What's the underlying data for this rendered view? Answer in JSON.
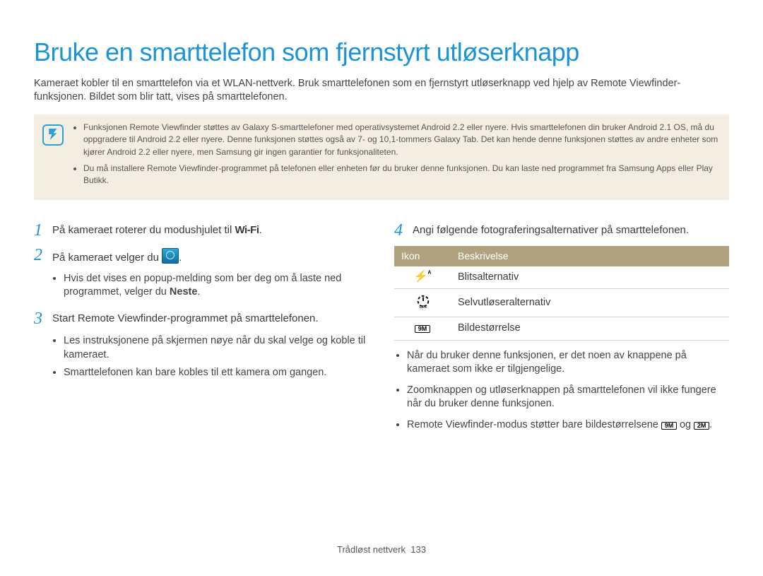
{
  "title": "Bruke en smarttelefon som fjernstyrt utløserknapp",
  "intro": "Kameraet kobler til en smarttelefon via et WLAN-nettverk. Bruk smarttelefonen som en fjernstyrt utløserknapp ved hjelp av Remote Viewfinder-funksjonen. Bildet som blir tatt, vises på smarttelefonen.",
  "notes": [
    "Funksjonen Remote Viewfinder støttes av Galaxy S-smarttelefoner med operativsystemet Android 2.2 eller nyere. Hvis smarttelefonen din bruker Android 2.1 OS, må du oppgradere til Android 2.2 eller nyere. Denne funksjonen støttes også av 7- og 10,1-tommers Galaxy Tab. Det kan hende denne funksjonen støttes av andre enheter som kjører Android 2.2 eller nyere, men Samsung gir ingen garantier for funksjonaliteten.",
    "Du må installere Remote Viewfinder-programmet på telefonen eller enheten før du bruker denne funksjonen. Du kan laste ned programmet fra Samsung Apps eller Play Butikk."
  ],
  "left": {
    "step1": {
      "num": "1",
      "pre": "På kameraet roterer du modushjulet til ",
      "wifi": "Wi-Fi",
      "post": "."
    },
    "step2": {
      "num": "2",
      "pre": "På kameraet velger du ",
      "post": "."
    },
    "step2_sub_pre": "Hvis det vises en popup-melding som ber deg om å laste ned programmet, velger du ",
    "step2_sub_bold": "Neste",
    "step2_sub_post": ".",
    "step3": {
      "num": "3",
      "text": "Start Remote Viewfinder-programmet på smarttelefonen."
    },
    "step3_subs": [
      "Les instruksjonene på skjermen nøye når du skal velge og koble til kameraet.",
      "Smarttelefonen kan bare kobles til ett kamera om gangen."
    ]
  },
  "right": {
    "step4": {
      "num": "4",
      "text": "Angi følgende fotograferingsalternativer på smarttelefonen."
    },
    "table": {
      "head": {
        "icon": "Ikon",
        "desc": "Beskrivelse"
      },
      "rows": [
        {
          "desc": "Blitsalternativ"
        },
        {
          "desc": "Selvutløseralternativ"
        },
        {
          "desc": "Bildestørrelse"
        }
      ]
    },
    "bullets_a": "Når du bruker denne funksjonen, er det noen av knappene på kameraet som ikke er tilgjengelige.",
    "bullets_b": "Zoomknappen og utløserknappen på smarttelefonen vil ikke fungere når du bruker denne funksjonen.",
    "bullets_c_pre": "Remote Viewfinder-modus støtter bare bildestørrelsene ",
    "bullets_c_mid": " og ",
    "bullets_c_post": ".",
    "size_9m": "9M",
    "size_2m": "2M"
  },
  "footer": {
    "section": "Trådløst nettverk",
    "page": "133"
  }
}
